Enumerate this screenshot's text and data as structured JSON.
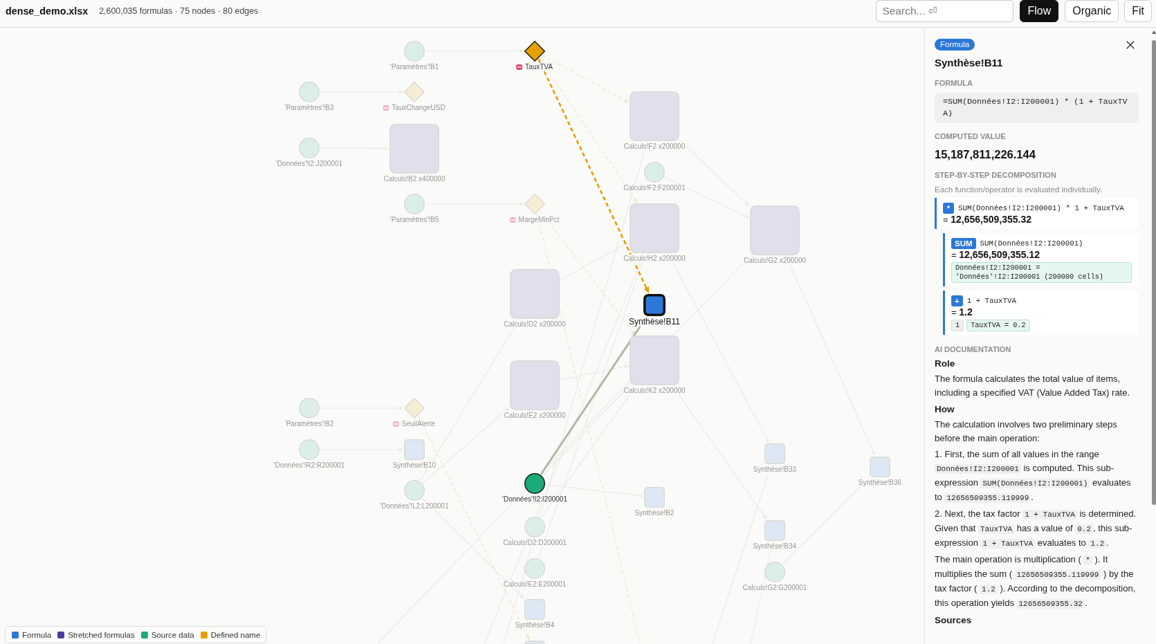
{
  "file": {
    "name": "dense_demo.xlsx",
    "stats": "2,600,035 formulas · 75 nodes · 80 edges"
  },
  "toolbar": {
    "search": {
      "placeholder": "Search... ⏎"
    },
    "layouts": [
      {
        "label": "Flow",
        "selected": true
      },
      {
        "label": "Organic",
        "selected": false
      }
    ],
    "fit": {
      "label": "Fit"
    }
  },
  "graph": {
    "nodes": [
      {
        "label": "'Paramètres'!B1",
        "kind": "source",
        "selected": false,
        "dimmed": true
      },
      {
        "label": "TauxTVA",
        "kind": "name",
        "selected": false,
        "dimmed": false
      },
      {
        "label": "'Paramètres'!B3",
        "kind": "source",
        "selected": false,
        "dimmed": true
      },
      {
        "label": "TauxChangeUSD",
        "kind": "name",
        "selected": false,
        "dimmed": true
      },
      {
        "label": "Calculs!F2 x200000",
        "kind": "stretched",
        "selected": false,
        "dimmed": true
      },
      {
        "label": "'Données'!I2:J200001",
        "kind": "source",
        "selected": false,
        "dimmed": true
      },
      {
        "label": "Calculs!B2 x400000",
        "kind": "stretched",
        "selected": false,
        "dimmed": true
      },
      {
        "label": "Calculs!F2:F200001",
        "kind": "source",
        "selected": false,
        "dimmed": true
      },
      {
        "label": "'Paramètres'!B5",
        "kind": "source",
        "selected": false,
        "dimmed": true
      },
      {
        "label": "MargeMinPct",
        "kind": "name",
        "selected": false,
        "dimmed": true
      },
      {
        "label": "Calculs!H2 x200000",
        "kind": "stretched",
        "selected": false,
        "dimmed": true
      },
      {
        "label": "Calculs!G2 x200000",
        "kind": "stretched",
        "selected": false,
        "dimmed": true
      },
      {
        "label": "Calculs!D2 x200000",
        "kind": "stretched",
        "selected": false,
        "dimmed": true
      },
      {
        "label": "Synthèse!B11",
        "kind": "formula",
        "selected": true,
        "dimmed": false
      },
      {
        "label": "Calculs!K2 x200000",
        "kind": "stretched",
        "selected": false,
        "dimmed": true
      },
      {
        "label": "Calculs!E2 x200000",
        "kind": "stretched",
        "selected": false,
        "dimmed": true
      },
      {
        "label": "'Paramètres'!B2",
        "kind": "source",
        "selected": false,
        "dimmed": true
      },
      {
        "label": "SeuilAlerte",
        "kind": "name",
        "selected": false,
        "dimmed": true
      },
      {
        "label": "'Données'!R2:R200001",
        "kind": "source",
        "selected": false,
        "dimmed": true
      },
      {
        "label": "Synthèse!B10",
        "kind": "formula",
        "selected": false,
        "dimmed": true
      },
      {
        "label": "Synthèse!B33",
        "kind": "formula",
        "selected": false,
        "dimmed": true
      },
      {
        "label": "Synthèse!B36",
        "kind": "formula",
        "selected": false,
        "dimmed": true
      },
      {
        "label": "'Données'!I2:I200001",
        "kind": "source",
        "selected": false,
        "dimmed": false
      },
      {
        "label": "'Données'!L2:L200001",
        "kind": "source",
        "selected": false,
        "dimmed": true
      },
      {
        "label": "Synthèse!B2",
        "kind": "formula",
        "selected": false,
        "dimmed": true
      },
      {
        "label": "Calculs!D2:D200001",
        "kind": "source",
        "selected": false,
        "dimmed": true
      },
      {
        "label": "Synthèse!B34",
        "kind": "formula",
        "selected": false,
        "dimmed": true
      },
      {
        "label": "Calculs!E2:E200001",
        "kind": "source",
        "selected": false,
        "dimmed": true
      },
      {
        "label": "Calculs!G2:G200001",
        "kind": "source",
        "selected": false,
        "dimmed": true
      },
      {
        "label": "Synthèse!B4",
        "kind": "formula",
        "selected": false,
        "dimmed": true
      },
      {
        "kind": "formula",
        "selected": false,
        "dimmed": true
      }
    ],
    "legend": [
      {
        "label": "Formula",
        "kind": "formula",
        "color": "#2b78d9"
      },
      {
        "label": "Stretched formulas",
        "kind": "stretched",
        "color": "#4a3b9c"
      },
      {
        "label": "Source data",
        "kind": "source",
        "color": "#1aab78"
      },
      {
        "label": "Defined name",
        "kind": "name",
        "color": "#e8a000"
      }
    ]
  },
  "details": {
    "badge": "Formula",
    "title": "Synthèse!B11",
    "formula": {
      "heading": "FORMULA",
      "code": "=SUM(Données!I2:I200001) * (1 + TauxTVA)"
    },
    "computed": {
      "heading": "COMPUTED VALUE",
      "value": "15,187,811,226.144"
    },
    "decomposition": {
      "heading": "STEP-BY-STEP DECOMPOSITION",
      "note": "Each function/operator is evaluated individually.",
      "steps": [
        {
          "op": "*",
          "expression": "SUM(Données!I2:I200001) * 1 + TauxTVA",
          "result": "= **12,656,509,355.32**",
          "children": [
            {
              "op": "SUM",
              "expression": "SUM(Données!I2:I200001)",
              "result": "= **12,656,509,355.12**",
              "refs": [
                {
                  "text": "Données!I2:I200001 = 'Données'!I2:I200001 (200000 cells)",
                  "kind": "reference"
                }
              ]
            },
            {
              "op": "+",
              "expression": "1 + TauxTVA",
              "result": "= **1.2**",
              "refs": [
                {
                  "text": "1",
                  "kind": "literal"
                },
                {
                  "text": "TauxTVA = 0.2",
                  "kind": "reference"
                }
              ]
            }
          ]
        }
      ]
    },
    "docs": {
      "heading": "AI DOCUMENTATION",
      "blocks": [
        {
          "kind": "subheading",
          "text": "Role"
        },
        {
          "kind": "paragraph",
          "parts": [
            {
              "kind": "text",
              "text": "The formula calculates the total value of items, including a specified VAT (Value Added Tax) rate."
            }
          ]
        },
        {
          "kind": "subheading",
          "text": "How"
        },
        {
          "kind": "paragraph",
          "parts": [
            {
              "kind": "text",
              "text": "The calculation involves two preliminary steps before the main operation:"
            }
          ]
        },
        {
          "kind": "paragraph",
          "parts": [
            {
              "kind": "text",
              "text": "1. First, the sum of all values in the range "
            },
            {
              "kind": "code",
              "text": "Données!I2:I200001"
            },
            {
              "kind": "text",
              "text": " is computed. This sub-expression "
            },
            {
              "kind": "code",
              "text": "SUM(Données!I2:I200001)"
            },
            {
              "kind": "text",
              "text": " evaluates to "
            },
            {
              "kind": "code",
              "text": "12656509355.119999"
            },
            {
              "kind": "text",
              "text": "."
            }
          ]
        },
        {
          "kind": "paragraph",
          "parts": [
            {
              "kind": "text",
              "text": "2. Next, the tax factor "
            },
            {
              "kind": "code",
              "text": "1 + TauxTVA"
            },
            {
              "kind": "text",
              "text": " is determined. Given that "
            },
            {
              "kind": "code",
              "text": "TauxTVA"
            },
            {
              "kind": "text",
              "text": " has a value of "
            },
            {
              "kind": "code",
              "text": "0.2"
            },
            {
              "kind": "text",
              "text": ", this sub-expression "
            },
            {
              "kind": "code",
              "text": "1 + TauxTVA"
            },
            {
              "kind": "text",
              "text": " evaluates to "
            },
            {
              "kind": "code",
              "text": "1.2"
            },
            {
              "kind": "text",
              "text": "."
            }
          ]
        },
        {
          "kind": "paragraph",
          "parts": [
            {
              "kind": "text",
              "text": "The main operation is multiplication ( "
            },
            {
              "kind": "code",
              "text": "*"
            },
            {
              "kind": "text",
              "text": " ). It multiplies the sum ( "
            },
            {
              "kind": "code",
              "text": "12656509355.119999"
            },
            {
              "kind": "text",
              "text": " ) by the tax factor ( "
            },
            {
              "kind": "code",
              "text": "1.2"
            },
            {
              "kind": "text",
              "text": " ). According to the decomposition, this operation yields "
            },
            {
              "kind": "code",
              "text": "12656509355.32"
            },
            {
              "kind": "text",
              "text": "."
            }
          ]
        },
        {
          "kind": "subheading",
          "text": "Sources"
        }
      ]
    }
  }
}
